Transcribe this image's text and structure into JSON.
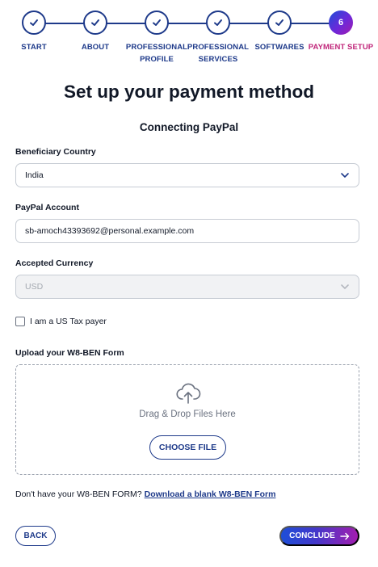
{
  "stepper": {
    "steps": [
      {
        "label": "START",
        "state": "completed",
        "icon": "check-icon"
      },
      {
        "label": "ABOUT",
        "state": "completed",
        "icon": "check-icon"
      },
      {
        "label": "PROFESSIONAL PROFILE",
        "state": "completed",
        "icon": "check-icon"
      },
      {
        "label": "PROFESSIONAL SERVICES",
        "state": "completed",
        "icon": "check-icon"
      },
      {
        "label": "SOFTWARES",
        "state": "completed",
        "icon": "check-icon"
      },
      {
        "label": "PAYMENT SETUP",
        "state": "active",
        "number": "6"
      }
    ],
    "color_completed": "#1e3a8a",
    "color_active_label": "#c0267a"
  },
  "page": {
    "title": "Set up your payment method",
    "subtitle": "Connecting PayPal"
  },
  "form": {
    "beneficiary_country": {
      "label": "Beneficiary Country",
      "value": "India",
      "icon": "chevron-down-icon"
    },
    "paypal_account": {
      "label": "PayPal Account",
      "value": "sb-amoch43393692@personal.example.com"
    },
    "accepted_currency": {
      "label": "Accepted Currency",
      "value": "USD",
      "disabled": true,
      "icon": "chevron-down-icon"
    },
    "us_tax_payer": {
      "label": "I am a US Tax payer",
      "checked": false
    },
    "upload": {
      "label": "Upload your W8-BEN Form",
      "icon": "cloud-upload-icon",
      "drop_text": "Drag & Drop Files Here",
      "choose_label": "CHOOSE FILE"
    },
    "download": {
      "prompt": "Don't have your W8-BEN FORM?",
      "link": "Download a blank W8-BEN Form"
    }
  },
  "footer": {
    "back_label": "BACK",
    "conclude_label": "CONCLUDE",
    "conclude_icon": "arrow-right-icon"
  }
}
